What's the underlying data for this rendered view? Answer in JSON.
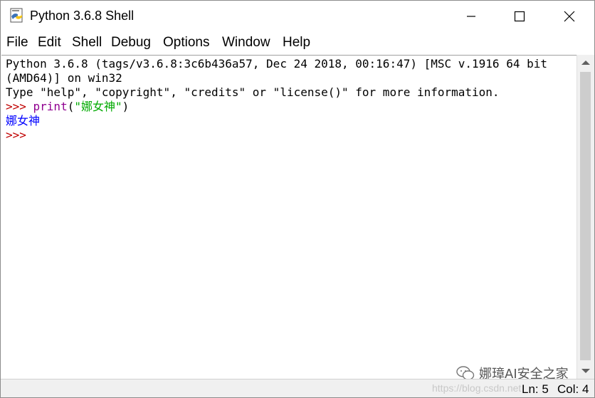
{
  "window": {
    "title": "Python 3.6.8 Shell",
    "icon": "python-idle-icon"
  },
  "menu": [
    {
      "label": "File"
    },
    {
      "label": "Edit"
    },
    {
      "label": "Shell"
    },
    {
      "label": "Debug"
    },
    {
      "label": "Options"
    },
    {
      "label": "Window"
    },
    {
      "label": "Help"
    }
  ],
  "shell": {
    "banner_line1": "Python 3.6.8 (tags/v3.6.8:3c6b436a57, Dec 24 2018, 00:16:47) [MSC v.1916 64 bit",
    "banner_line2": "(AMD64)] on win32",
    "banner_line3": "Type \"help\", \"copyright\", \"credits\" or \"license()\" for more information.",
    "prompt": ">>> ",
    "command_func": "print",
    "command_open": "(",
    "command_string": "\"娜女神\"",
    "command_close": ")",
    "output": "娜女神",
    "prompt2": ">>>"
  },
  "status": {
    "ln": "Ln: 5",
    "col": "Col: 4"
  },
  "watermark": {
    "brand": "娜璋AI安全之家",
    "url": "https://blog.csdn.net"
  },
  "colors": {
    "prompt": "#c00000",
    "builtin": "#900090",
    "string": "#00aa00",
    "output": "#0000ff"
  }
}
